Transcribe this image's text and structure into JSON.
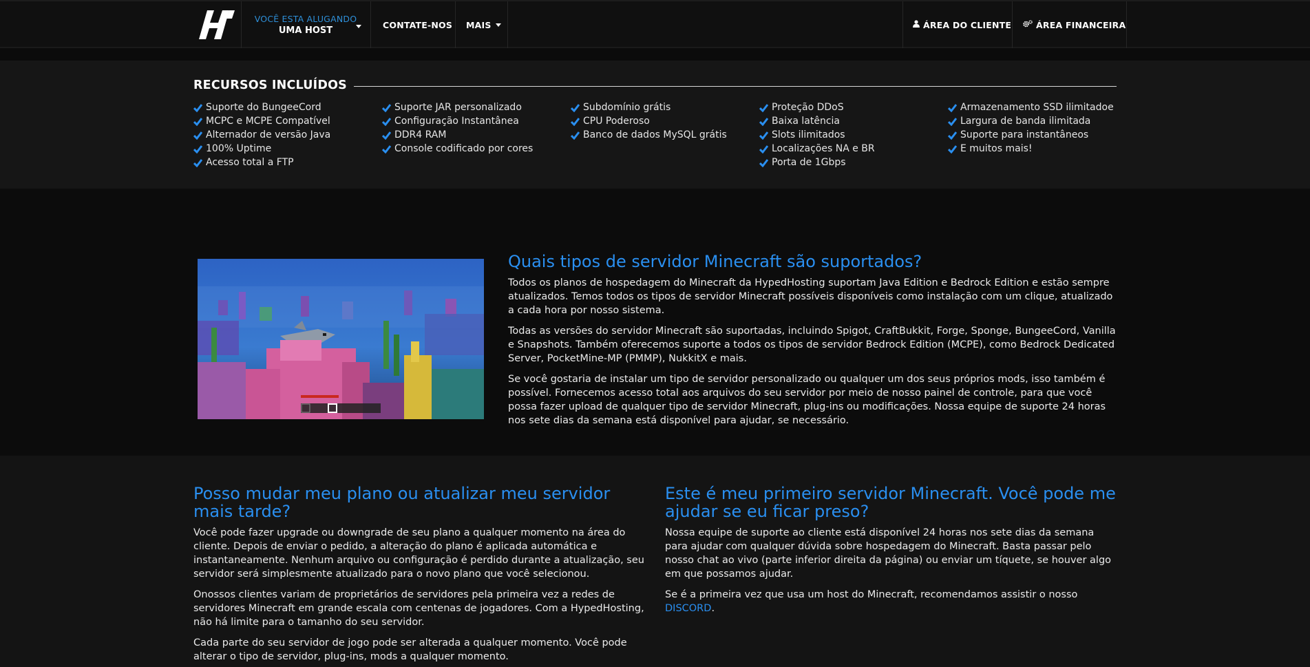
{
  "navbar": {
    "rent_top": "VOCÊ ESTA ALUGANDO",
    "rent_bottom": "UMA HOST",
    "contact": "CONTATE-NOS",
    "more": "MAIS",
    "client_area": "ÁREA DO CLIENTE",
    "financial_area": "ÁREA FINANCEIRA",
    "logo_icon": "hypedhosting-logo",
    "client_icon": "user-icon",
    "financial_icon": "gears-icon"
  },
  "features": {
    "title": "RECURSOS INCLUÍDOS",
    "check_color": "#2a8ff0",
    "columns": [
      [
        "Suporte do BungeeCord",
        "MCPC e MCPE Compatível",
        "Alternador de versão Java",
        "100% Uptime",
        "Acesso total a FTP"
      ],
      [
        "Suporte JAR personalizado",
        "Configuração Instantânea",
        "DDR4 RAM",
        "Console codificado por cores"
      ],
      [
        "Subdomínio grátis",
        "CPU Poderoso",
        "Banco de dados MySQL grátis"
      ],
      [
        "Proteção DDoS",
        "Baixa latência",
        "Slots ilimitados",
        "Localizações NA e BR",
        "Porta de 1Gbps"
      ],
      [
        "Armazenamento SSD ilimitadoe",
        "Largura de banda ilimitada",
        "Suporte para instantâneos",
        "E muitos mais!"
      ]
    ]
  },
  "server_types": {
    "title": "Quais tipos de servidor Minecraft são suportados?",
    "paragraphs": [
      "Todos os planos de hospedagem do Minecraft da HypedHosting suportam Java Edition e Bedrock Edition e estão sempre atualizados. Temos todos os tipos de servidor Minecraft possíveis disponíveis como instalação com um clique, atualizado a cada hora por nosso sistema.",
      "Todas as versões do servidor Minecraft são suportadas, incluindo Spigot, CraftBukkit, Forge, Sponge, BungeeCord, Vanilla e Snapshots. Também oferecemos suporte a todos os tipos de servidor Bedrock Edition (MCPE), como Bedrock Dedicated Server, PocketMine-MP (PMMP), NukkitX e mais.",
      "Se você gostaria de instalar um tipo de servidor personalizado ou qualquer um dos seus próprios mods, isso também é possível. Fornecemos acesso total aos arquivos do seu servidor por meio de nosso painel de controle, para que você possa fazer upload de qualquer tipo de servidor Minecraft, plug-ins ou modificações. Nossa equipe de suporte 24 horas nos sete dias da semana está disponível para ajudar, se necessário."
    ]
  },
  "upgrade": {
    "title": "Posso mudar meu plano ou atualizar meu servidor mais tarde?",
    "paragraphs": [
      "Você pode fazer upgrade ou downgrade de seu plano a qualquer momento na área do cliente. Depois de enviar o pedido, a alteração do plano é aplicada automática e instantaneamente. Nenhum arquivo ou configuração é perdido durante a atualização, seu servidor será simplesmente atualizado para o novo plano que você selecionou.",
      "Onossos clientes variam de proprietários de servidores pela primeira vez a redes de servidores Minecraft em grande escala com centenas de jogadores. Com a HypedHosting, não há limite para o tamanho do seu servidor.",
      "Cada parte do seu servidor de jogo pode ser alterada a qualquer momento. Você pode alterar o tipo de servidor, plug-ins, mods a qualquer momento."
    ]
  },
  "first_server": {
    "title": "Este é meu primeiro servidor Minecraft. Você pode me ajudar se eu ficar preso?",
    "paragraph1": "Nossa equipe de suporte ao cliente está disponível 24 horas nos sete dias da semana para ajudar com qualquer dúvida sobre hospedagem do Minecraft. Basta passar pelo nosso chat ao vivo (parte inferior direita da página) ou enviar um tíquete, se houver algo em que possamos ajudar.",
    "paragraph2_prefix": "Se é a primeira vez que usa um host do Minecraft, recomendamos assistir o nosso ",
    "discord_link": "DISCORD",
    "paragraph2_suffix": "."
  }
}
